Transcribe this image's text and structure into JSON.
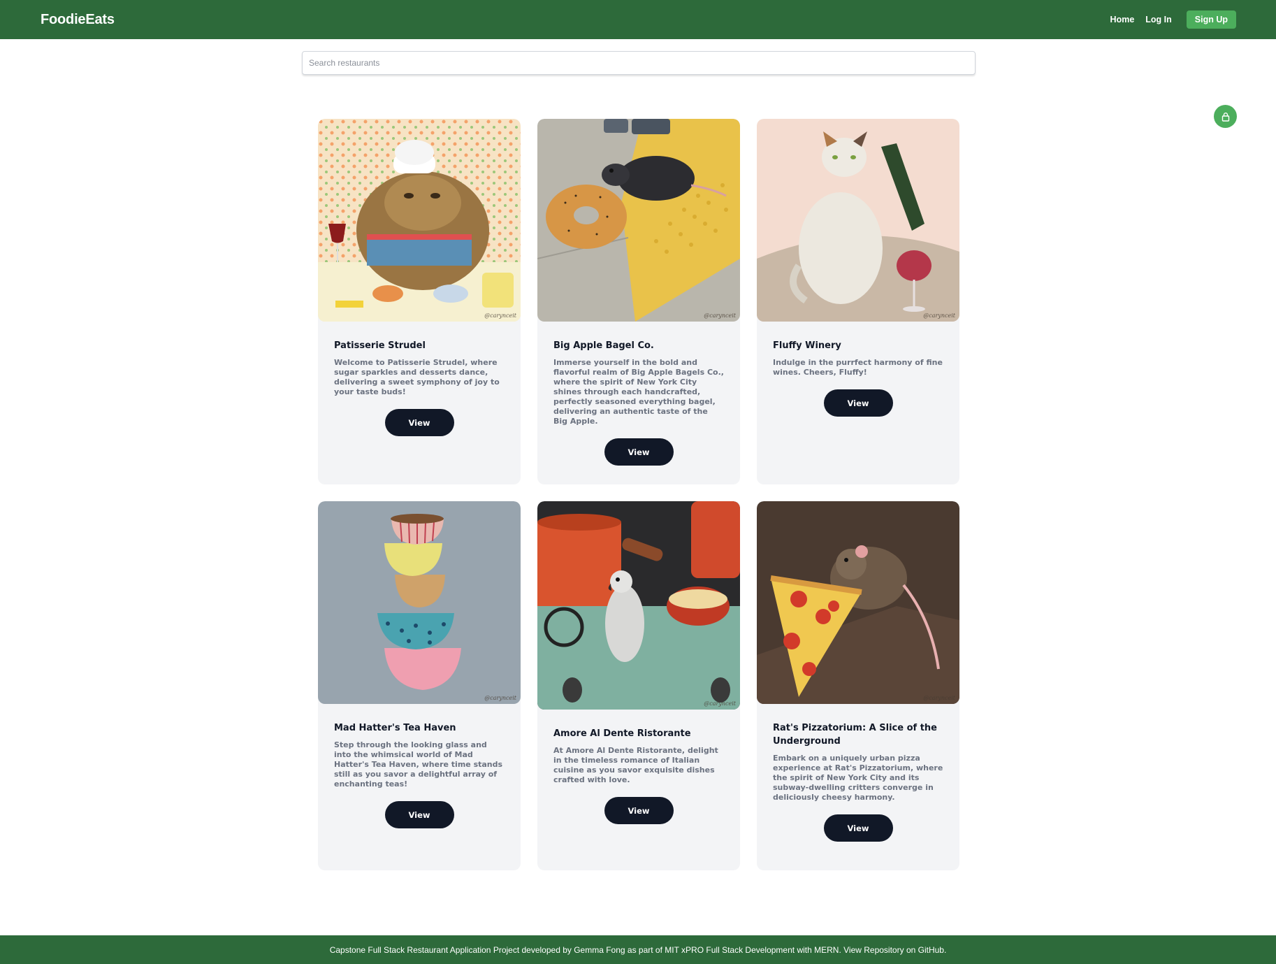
{
  "header": {
    "brand": "FoodieEats",
    "nav": {
      "home": "Home",
      "login": "Log In",
      "signup": "Sign Up"
    }
  },
  "search": {
    "placeholder": "Search restaurants",
    "value": ""
  },
  "cart": {
    "icon": "lock-icon"
  },
  "restaurants": [
    {
      "name": "Patisserie Strudel",
      "description": "Welcome to Patisserie Strudel, where sugar sparkles and desserts dance, delivering a sweet symphony of joy to your taste buds!",
      "button": "View",
      "signature": "@carynceit"
    },
    {
      "name": "Big Apple Bagel Co.",
      "description": "Immerse yourself in the bold and flavorful realm of Big Apple Bagels Co., where the spirit of New York City shines through each handcrafted, perfectly seasoned everything bagel, delivering an authentic taste of the Big Apple.",
      "button": "View",
      "signature": "@carynceit"
    },
    {
      "name": "Fluffy Winery",
      "description": "Indulge in the purrfect harmony of fine wines. Cheers, Fluffy!",
      "button": "View",
      "signature": "@carynceit"
    },
    {
      "name": "Mad Hatter's Tea Haven",
      "description": "Step through the looking glass and into the whimsical world of Mad Hatter's Tea Haven, where time stands still as you savor a delightful array of enchanting teas!",
      "button": "View",
      "signature": "@carynceit"
    },
    {
      "name": "Amore Al Dente Ristorante",
      "description": "At Amore Al Dente Ristorante, delight in the timeless romance of Italian cuisine as you savor exquisite dishes crafted with love.",
      "button": "View",
      "signature": "@carynceit"
    },
    {
      "name": "Rat's Pizzatorium: A Slice of the Underground",
      "description": "Embark on a uniquely urban pizza experience at Rat's Pizzatorium, where the spirit of New York City and its subway-dwelling critters converge in deliciously cheesy harmony.",
      "button": "View",
      "signature": "@carynceit"
    }
  ],
  "footer": {
    "text": "Capstone Full Stack Restaurant Application Project developed by Gemma Fong as part of MIT xPRO Full Stack Development with MERN. View Repository on GitHub."
  },
  "colors": {
    "header_bg": "#2d6a3a",
    "accent_green": "#4cae5c",
    "button_dark": "#111827",
    "card_bg": "#f3f4f6",
    "text_muted": "#6b7280"
  }
}
